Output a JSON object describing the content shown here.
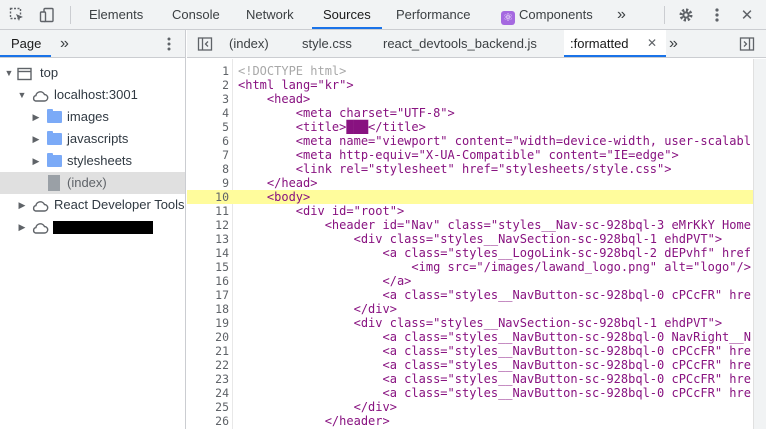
{
  "toolbar": {
    "tabs": [
      {
        "label": "Elements"
      },
      {
        "label": "Console"
      },
      {
        "label": "Network"
      },
      {
        "label": "Sources"
      },
      {
        "label": "Performance"
      },
      {
        "label": "Components"
      }
    ],
    "more_label": "»",
    "settings_icon": "gear-icon",
    "menu_icon": "kebab-icon",
    "close_label": "✕"
  },
  "navigator": {
    "tab_label": "Page",
    "more_label": "»",
    "tree": [
      {
        "label": "top",
        "icon": "frame-icon"
      },
      {
        "label": "localhost:3001",
        "icon": "cloud-icon"
      },
      {
        "label": "images",
        "icon": "folder-icon"
      },
      {
        "label": "javascripts",
        "icon": "folder-icon"
      },
      {
        "label": "stylesheets",
        "icon": "folder-icon"
      },
      {
        "label": "(index)",
        "icon": "file-icon"
      },
      {
        "label": "React Developer Tools",
        "icon": "cloud-icon"
      }
    ]
  },
  "editor": {
    "tabs": [
      {
        "label": "(index)"
      },
      {
        "label": "style.css"
      },
      {
        "label": "react_devtools_backend.js"
      },
      {
        "label": ":formatted"
      }
    ],
    "close_label": "✕",
    "more_label": "»",
    "lines": [
      {
        "n": "1",
        "text": "<!DOCTYPE html>"
      },
      {
        "n": "2",
        "text": "<html lang=\"kr\">"
      },
      {
        "n": "3",
        "text": "    <head>"
      },
      {
        "n": "4",
        "text": "        <meta charset=\"UTF-8\">"
      },
      {
        "n": "5",
        "text": "        <title>███</title>"
      },
      {
        "n": "6",
        "text": "        <meta name=\"viewport\" content=\"width=device-width, user-scalabl"
      },
      {
        "n": "7",
        "text": "        <meta http-equiv=\"X-UA-Compatible\" content=\"IE=edge\">"
      },
      {
        "n": "8",
        "text": "        <link rel=\"stylesheet\" href=\"stylesheets/style.css\">"
      },
      {
        "n": "9",
        "text": "    </head>"
      },
      {
        "n": "10",
        "text": "    <body>"
      },
      {
        "n": "11",
        "text": "        <div id=\"root\">"
      },
      {
        "n": "12",
        "text": "            <header id=\"Nav\" class=\"styles__Nav-sc-928bql-3 eMrKkY Home"
      },
      {
        "n": "13",
        "text": "                <div class=\"styles__NavSection-sc-928bql-1 ehdPVT\">"
      },
      {
        "n": "14",
        "text": "                    <a class=\"styles__LogoLink-sc-928bql-2 dEPvhf\" href"
      },
      {
        "n": "15",
        "text": "                        <img src=\"/images/lawand_logo.png\" alt=\"logo\"/>"
      },
      {
        "n": "16",
        "text": "                    </a>"
      },
      {
        "n": "17",
        "text": "                    <a class=\"styles__NavButton-sc-928bql-0 cPCcFR\" hre"
      },
      {
        "n": "18",
        "text": "                </div>"
      },
      {
        "n": "19",
        "text": "                <div class=\"styles__NavSection-sc-928bql-1 ehdPVT\">"
      },
      {
        "n": "20",
        "text": "                    <a class=\"styles__NavButton-sc-928bql-0 NavRight__N"
      },
      {
        "n": "21",
        "text": "                    <a class=\"styles__NavButton-sc-928bql-0 cPCcFR\" hre"
      },
      {
        "n": "22",
        "text": "                    <a class=\"styles__NavButton-sc-928bql-0 cPCcFR\" hre"
      },
      {
        "n": "23",
        "text": "                    <a class=\"styles__NavButton-sc-928bql-0 cPCcFR\" hre"
      },
      {
        "n": "24",
        "text": "                    <a class=\"styles__NavButton-sc-928bql-0 cPCcFR\" hre"
      },
      {
        "n": "25",
        "text": "                </div>"
      },
      {
        "n": "26",
        "text": "            </header>"
      }
    ],
    "highlighted_line": "10"
  },
  "colors": {
    "accent": "#1a73e8",
    "highlight": "#fffc9c",
    "tag": "#881280"
  }
}
